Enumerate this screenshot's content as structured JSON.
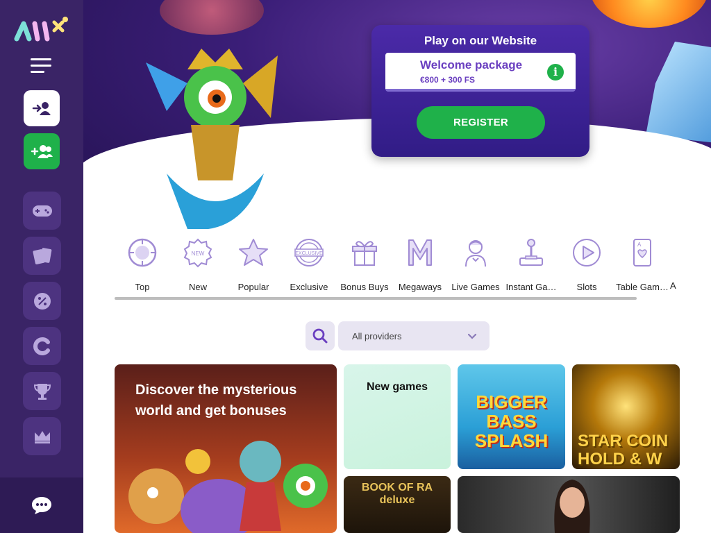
{
  "hero": {
    "card_title": "Play on our Website",
    "welcome_title": "Welcome package",
    "welcome_sub": "€800 + 300 FS",
    "info_glyph": "i",
    "register_label": "REGISTER"
  },
  "categories": [
    {
      "label": "Top",
      "icon": "top-icon"
    },
    {
      "label": "New",
      "icon": "new-badge-icon"
    },
    {
      "label": "Popular",
      "icon": "star-icon"
    },
    {
      "label": "Exclusive",
      "icon": "exclusive-badge-icon"
    },
    {
      "label": "Bonus Buys",
      "icon": "gift-icon"
    },
    {
      "label": "Megaways",
      "icon": "megaways-icon"
    },
    {
      "label": "Live Games",
      "icon": "dealer-icon"
    },
    {
      "label": "Instant Ga…",
      "icon": "joystick-icon"
    },
    {
      "label": "Slots",
      "icon": "play-icon"
    },
    {
      "label": "Table Gam…",
      "icon": "card-icon"
    }
  ],
  "categories_overflow": "A",
  "filter": {
    "provider_label": "All providers"
  },
  "tiles": {
    "promo_text": "Discover the mysterious world and get bonuses",
    "new_games": "New games",
    "game1": "BIGGER BASS SPLASH",
    "game2": "STAR COIN HOLD & W",
    "game3": "BOOK OF RA deluxe"
  },
  "colors": {
    "sidebar": "#3a2466",
    "accent_green": "#1fb14a",
    "brand_purple": "#6a3fc0"
  }
}
